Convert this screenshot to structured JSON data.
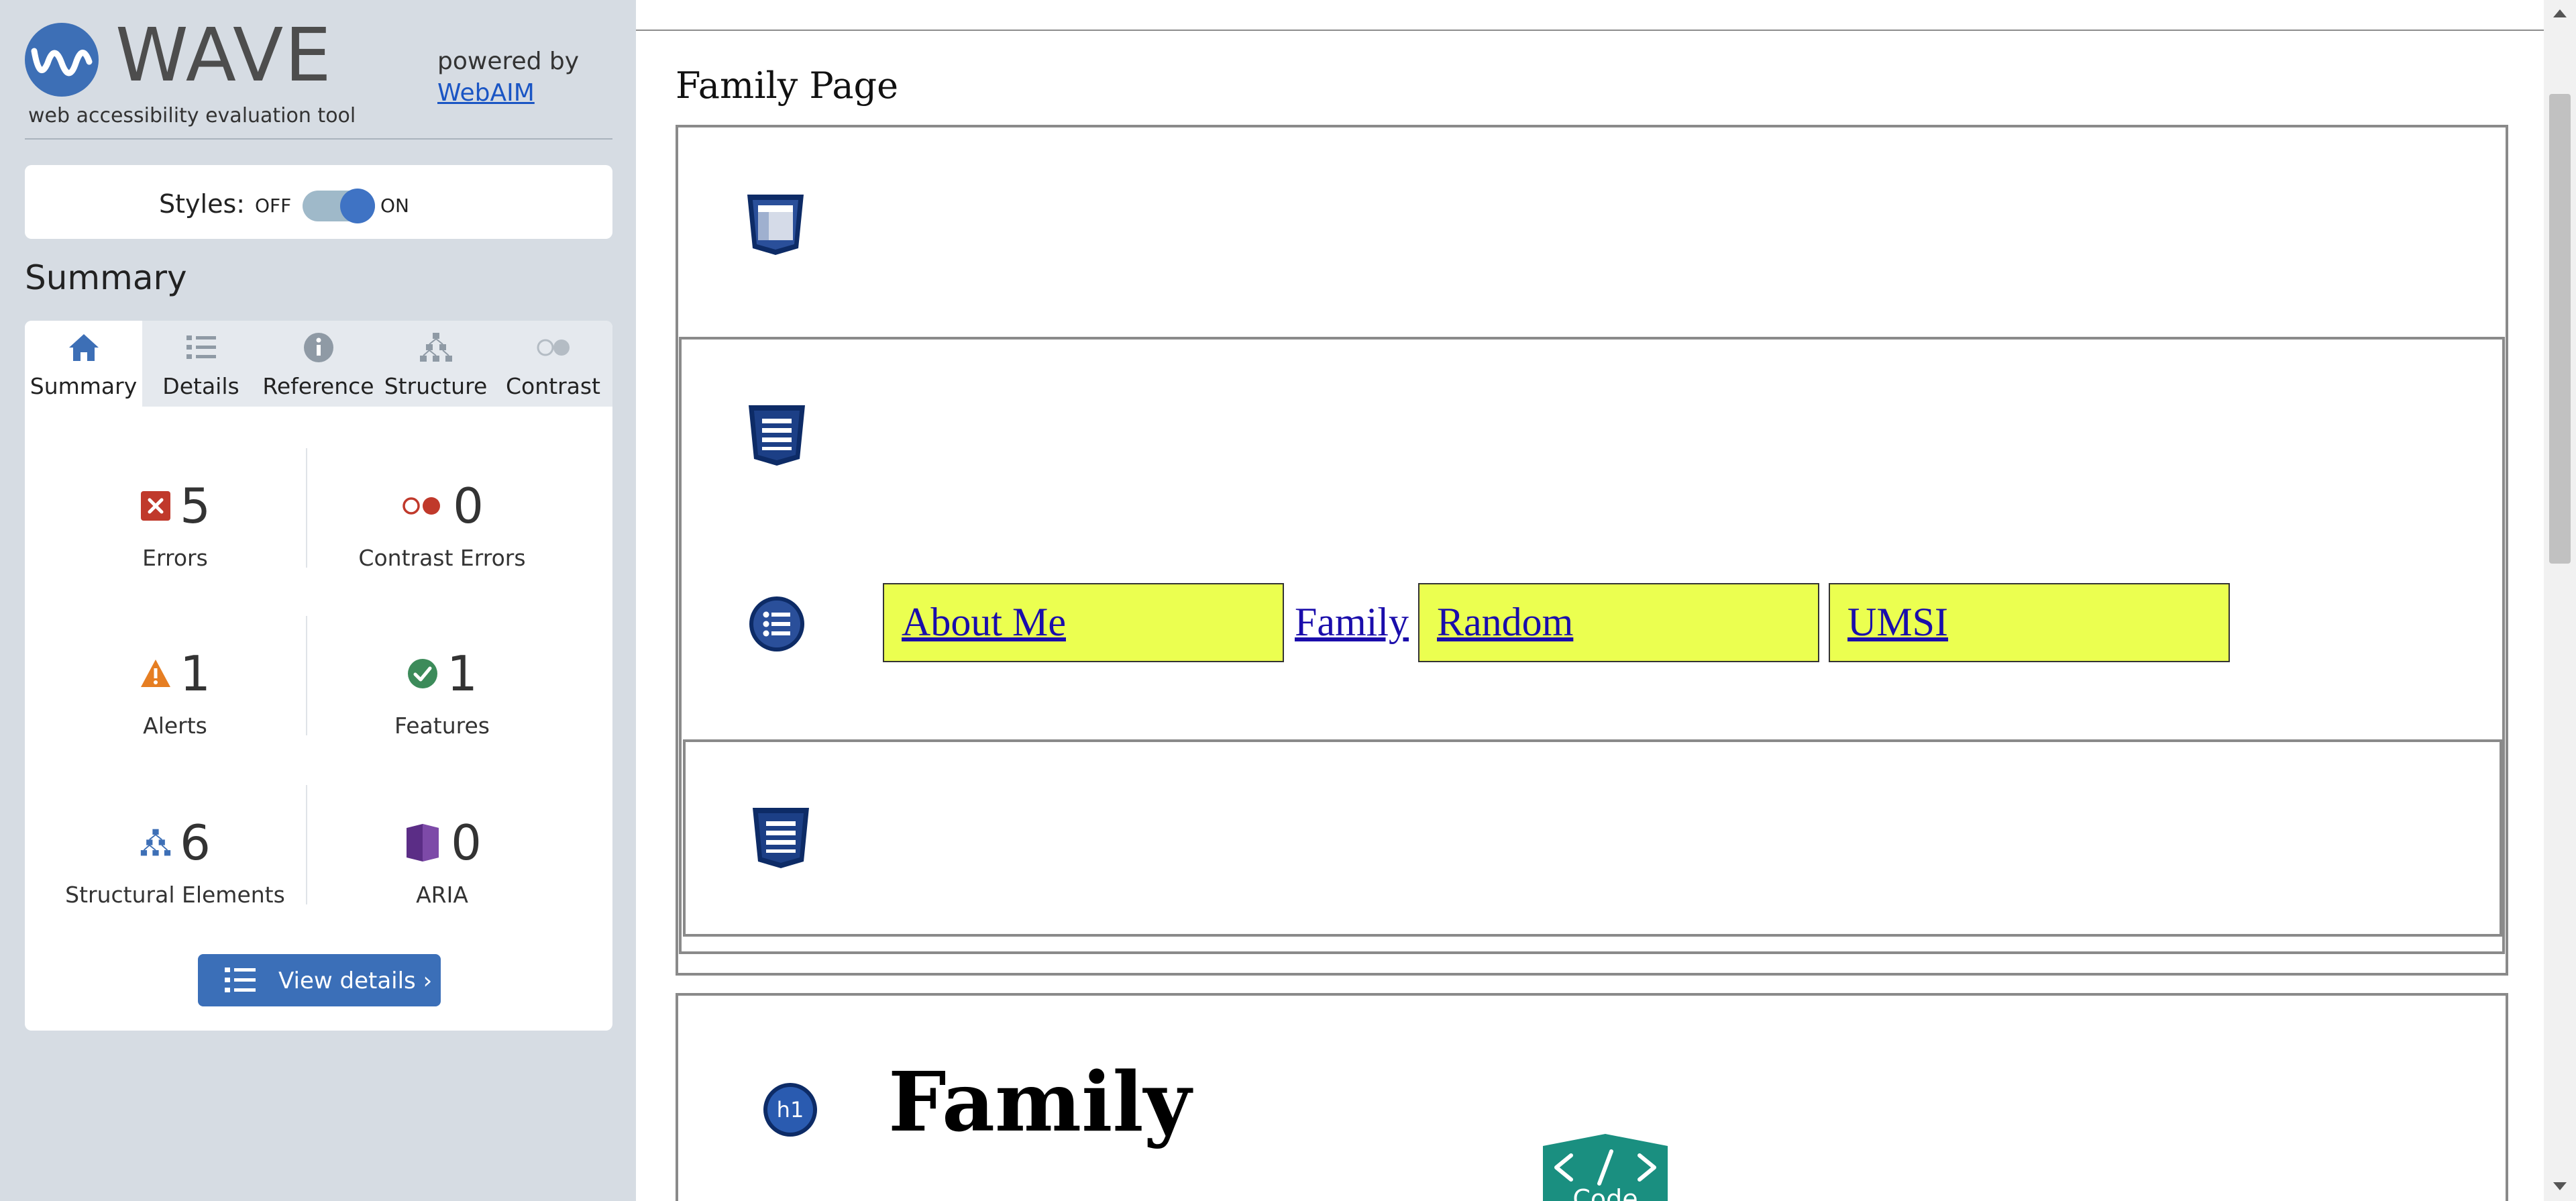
{
  "wave": {
    "title": "WAVE",
    "subtitle": "web accessibility evaluation tool",
    "powered_by": "powered by",
    "webaim_link": "WebAIM"
  },
  "styles_toggle": {
    "label": "Styles:",
    "off_label": "OFF",
    "on_label": "ON",
    "state": "on"
  },
  "summary_heading": "Summary",
  "tabs": [
    {
      "label": "Summary",
      "icon": "home-icon",
      "active": true
    },
    {
      "label": "Details",
      "icon": "list-icon",
      "active": false
    },
    {
      "label": "Reference",
      "icon": "info-icon",
      "active": false
    },
    {
      "label": "Structure",
      "icon": "hierarchy-icon",
      "active": false
    },
    {
      "label": "Contrast",
      "icon": "contrast-icon",
      "active": false
    }
  ],
  "stats": {
    "errors": {
      "count": "5",
      "label": "Errors",
      "icon": "error-icon"
    },
    "contrast_errors": {
      "count": "0",
      "label": "Contrast Errors",
      "icon": "contrast-error-icon"
    },
    "alerts": {
      "count": "1",
      "label": "Alerts",
      "icon": "alert-icon"
    },
    "features": {
      "count": "1",
      "label": "Features",
      "icon": "feature-check-icon"
    },
    "structural": {
      "count": "6",
      "label": "Structural Elements",
      "icon": "structure-icon"
    },
    "aria": {
      "count": "0",
      "label": "ARIA",
      "icon": "aria-icon"
    }
  },
  "view_details_button": "View details ›",
  "page": {
    "title": "Family Page",
    "nav_links": [
      "About Me",
      "Family",
      "Random",
      "UMSI"
    ],
    "h1": "Family",
    "h1_badge": "h1",
    "code_button": "Code"
  },
  "colors": {
    "sidebar_bg": "#d6dce3",
    "accent_blue": "#3b6fb8",
    "error_red": "#c0392b",
    "alert_orange": "#e67e22",
    "feature_green": "#3c8b5a",
    "aria_purple": "#5b2d86",
    "nav_highlight": "#ebff50",
    "code_teal": "#1a8f80"
  }
}
